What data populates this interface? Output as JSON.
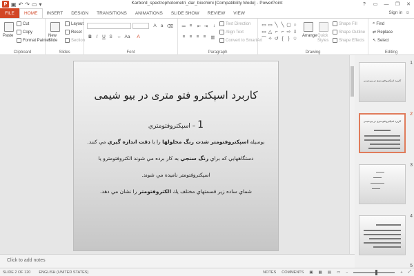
{
  "titlebar": {
    "title": "Karbord_spectrophotometri_dar_biochimi [Compatibility Mode] - PowerPoint",
    "app_icon": "P",
    "controls": [
      "?",
      "▭",
      "—",
      "❐",
      "✕"
    ]
  },
  "tabs": {
    "file": "FILE",
    "items": [
      "HOME",
      "INSERT",
      "DESIGN",
      "TRANSITIONS",
      "ANIMATIONS",
      "SLIDE SHOW",
      "REVIEW",
      "VIEW"
    ],
    "active": "HOME",
    "signin": "Sign in"
  },
  "ribbon": {
    "clipboard": {
      "label": "Clipboard",
      "paste": "Paste",
      "cut": "Cut",
      "copy": "Copy",
      "format_painter": "Format Painter"
    },
    "slides": {
      "label": "Slides",
      "new_slide": "New Slide",
      "layout": "Layout",
      "reset": "Reset",
      "section": "Section"
    },
    "font": {
      "label": "Font",
      "bold": "B",
      "italic": "I",
      "underline": "U",
      "strike": "S"
    },
    "paragraph": {
      "label": "Paragraph",
      "text_direction": "Text Direction",
      "align_text": "Align Text",
      "convert_smartart": "Convert to SmartArt"
    },
    "drawing": {
      "label": "Drawing",
      "arrange": "Arrange",
      "quick_styles": "Quick Styles",
      "shape_fill": "Shape Fill",
      "shape_outline": "Shape Outline",
      "shape_effects": "Shape Effects",
      "shapes": [
        "▭",
        "▭",
        "╲",
        "╲",
        "▢",
        "○",
        "▭",
        "△",
        "⌐",
        "⌐",
        "⇨",
        "⇩",
        "⌒",
        "✧",
        "↺",
        "{",
        "}",
        "☆"
      ]
    },
    "editing": {
      "label": "Editing",
      "find": "Find",
      "replace": "Replace",
      "select": "Select"
    }
  },
  "slide": {
    "title": "کاربرد اسپکترو فتو متری در بیو شیمی",
    "sub_num": "1",
    "sub_text": "– اسپکتروفتومتري",
    "line1_pre": "بوسيله ",
    "line1_b1": "اسپكتروفتومتر شدت رنگ محلولها",
    "line1_mid": " را با ",
    "line1_b2": "دقت اندازه گيري",
    "line1_post": " مي كنند.",
    "line2_pre": "دستگاههايي كه براي ",
    "line2_b": "رنگ سنجي",
    "line2_post": " به كار برده مي شوند الكتروفتومترو يا",
    "line3": "اسپكتروفتومتر ناميده مي شوند.",
    "line4_pre": "شماي ساده زير قسمتهاي مختلف يك ",
    "line4_b": "الكتروفتومتر",
    "line4_post": " را نشان مي دهد."
  },
  "notes": {
    "placeholder": "Click to add notes"
  },
  "thumbnails": [
    {
      "num": "1",
      "title": "کاربرد اسپکترو فتو متری در بیو شیمی",
      "selected": false
    },
    {
      "num": "2",
      "title": "کاربرد اسپکترو فتو متری در بیو شیمی",
      "selected": true
    },
    {
      "num": "3",
      "title": "",
      "selected": false
    },
    {
      "num": "4",
      "title": "",
      "selected": false
    },
    {
      "num": "5",
      "title": "",
      "selected": false
    }
  ],
  "statusbar": {
    "slide_info": "SLIDE 2 OF 120",
    "language": "ENGLISH (UNITED STATES)",
    "notes": "NOTES",
    "comments": "COMMENTS",
    "zoom_level": 0.55
  },
  "colors": {
    "accent": "#d24726",
    "selected_thumb": "#e07b5a"
  }
}
